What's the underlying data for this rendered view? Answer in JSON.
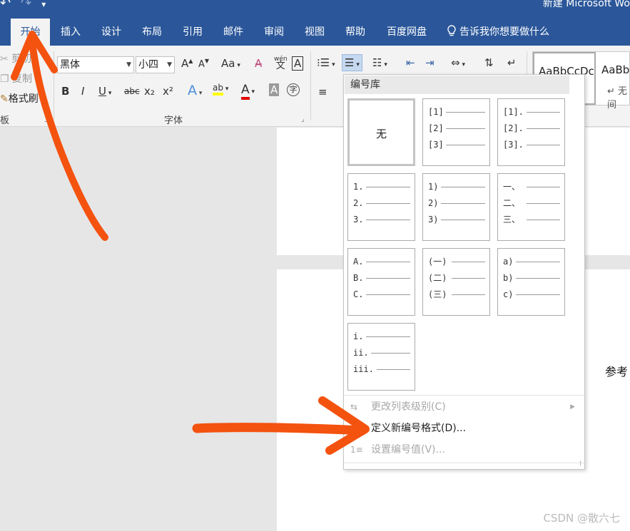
{
  "quick_access": {
    "undo_icon": "undo-icon",
    "redo_icon": "redo-icon",
    "customize_icon": "customize-icon"
  },
  "window": {
    "title": "新建 Microsoft Wo"
  },
  "tabs": [
    "开始",
    "插入",
    "设计",
    "布局",
    "引用",
    "邮件",
    "审阅",
    "视图",
    "帮助",
    "百度网盘"
  ],
  "active_tab": "开始",
  "tell_me": "告诉我你想要做什么",
  "clipboard": {
    "cut": "剪切",
    "copy": "复制",
    "format_painter": "格式刷",
    "group_label": "剪贴板"
  },
  "font": {
    "name": "黑体",
    "size": "小四",
    "group_label": "字体",
    "grow": "A",
    "shrink": "A",
    "change_case": "Aa",
    "phonetic_top": "wén",
    "phonetic_bottom": "文",
    "border_char": "A",
    "bold": "B",
    "italic": "I",
    "underline": "U",
    "strike": "abc",
    "subscript": "x₂",
    "superscript": "x²",
    "text_effect": "A",
    "highlight": "ab",
    "font_color": "A",
    "char_shading": "A",
    "enclose": "字"
  },
  "styles": [
    {
      "preview": "AaBbCcDc",
      "name": ""
    },
    {
      "preview": "AaBb",
      "name": "↵ 无间"
    }
  ],
  "numbering_library": {
    "header": "编号库",
    "tiles": [
      {
        "none_label": "无",
        "lines": []
      },
      {
        "lines": [
          "[1]",
          "[2]",
          "[3]"
        ]
      },
      {
        "lines": [
          "[1].",
          "[2].",
          "[3]."
        ]
      },
      {
        "lines": [
          "1.",
          "2.",
          "3."
        ]
      },
      {
        "lines": [
          "1)",
          "2)",
          "3)"
        ]
      },
      {
        "lines": [
          "一、",
          "二、",
          "三、"
        ]
      },
      {
        "lines": [
          "A.",
          "B.",
          "C."
        ]
      },
      {
        "lines": [
          "(一)",
          "(二)",
          "(三)"
        ]
      },
      {
        "lines": [
          "a)",
          "b)",
          "c)"
        ]
      },
      {
        "lines": [
          "i.",
          "ii.",
          "iii."
        ]
      }
    ],
    "menu": [
      {
        "label": "更改列表级别(C)",
        "enabled": false
      },
      {
        "label": "定义新编号格式(D)...",
        "enabled": true
      },
      {
        "label": "设置编号值(V)...",
        "enabled": false
      }
    ]
  },
  "document": {
    "visible_text": "参考"
  },
  "watermark": "CSDN @散六七",
  "colors": {
    "ribbon_blue": "#2b579a",
    "annotation_orange": "#f4520f",
    "highlight_yellow": "#ffff00",
    "font_color_red": "#e00000"
  }
}
